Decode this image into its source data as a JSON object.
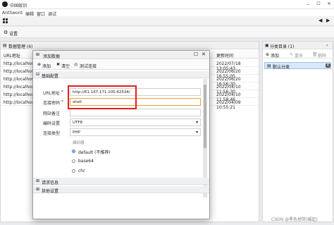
{
  "window": {
    "title": "中国蚁剑",
    "min": "–",
    "max": "☐",
    "close": "✕"
  },
  "menu": [
    "AntSword",
    "编辑",
    "窗口",
    "调试"
  ],
  "tabs": {
    "home_icon": "home-icon"
  },
  "settings": {
    "label": "设置"
  },
  "data_panel": {
    "title": "数据管理 (6)",
    "columns": {
      "url": "URL地址",
      "updated": "更新时间"
    },
    "rows": [
      {
        "url": "http://localhost:",
        "updated": "2022/07/18 13:05:43"
      },
      {
        "url": "http://localhost:",
        "updated": "2022/06/20 16:55:05"
      },
      {
        "url": "http://localhost:",
        "updated": "2022/06/20 16:56:30"
      },
      {
        "url": "http://localhost:",
        "updated": "2022/04/10 11:56:30"
      },
      {
        "url": "http://localhost:",
        "updated": "2022/04/10 11:58:46"
      },
      {
        "url": "http://localhost:",
        "updated": "2022/04/09 10:55:21"
      }
    ]
  },
  "category_panel": {
    "title": "分类目录 (1)",
    "buttons": {
      "add": "添加",
      "rename": "重命",
      "delete": "删除"
    },
    "items": [
      {
        "name": "默认分类",
        "count": "6"
      }
    ]
  },
  "dialog": {
    "title": "添加数据",
    "toolbar": {
      "add": "添加",
      "clear": "清空",
      "test": "测试连接"
    },
    "sections": {
      "basic": "基础配置",
      "request": "请求信息",
      "other": "其他设置"
    },
    "fields": {
      "url_label": "URL地址",
      "url_value": "http://61.147.171.105:62534/",
      "pwd_label": "连接密码",
      "pwd_value": "shell",
      "note_label": "网站备注",
      "note_value": "",
      "encoding_label": "编码设置",
      "encoding_value": "UTF8",
      "type_label": "连接类型",
      "type_value": "PHP",
      "encoder_group": "编码器",
      "encoders": [
        "default (不推荐)",
        "base64",
        "chr"
      ]
    },
    "required_mark": "*"
  },
  "watermark": "CSDN @黑色地带(崛起)"
}
